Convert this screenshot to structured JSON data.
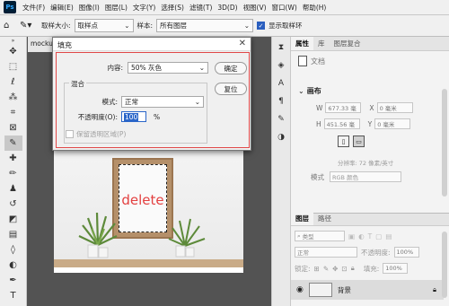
{
  "menubar": {
    "logo": "Ps",
    "items": [
      "文件(F)",
      "编辑(E)",
      "图像(I)",
      "图层(L)",
      "文字(Y)",
      "选择(S)",
      "滤镜(T)",
      "3D(D)",
      "视图(V)",
      "窗口(W)",
      "帮助(H)"
    ]
  },
  "options": {
    "sample_size_label": "取样大小:",
    "sample_size_value": "取样点",
    "sample_label": "样本:",
    "sample_value": "所有图层",
    "show_ring_label": "显示取样环"
  },
  "doc_tab": {
    "name": "mocku"
  },
  "canvas": {
    "frame_text": "delete"
  },
  "dialog": {
    "title": "填充",
    "content_label": "内容:",
    "content_value": "50% 灰色",
    "ok_label": "确定",
    "reset_label": "复位",
    "blend_group_label": "混合",
    "mode_label": "模式:",
    "mode_value": "正常",
    "opacity_label": "不透明度(O):",
    "opacity_value": "100",
    "opacity_unit": "%",
    "preserve_transparency_label": "保留透明区域(P)"
  },
  "properties": {
    "tabs": [
      "属性",
      "库",
      "图层复合"
    ],
    "doc_label": "文档",
    "canvas_section": "画布",
    "w_label": "W",
    "w_value": "677.33 毫",
    "h_label": "H",
    "h_value": "451.56 毫",
    "x_label": "X",
    "x_value": "0 毫米",
    "y_label": "Y",
    "y_value": "0 毫米",
    "resolution": "分辨率: 72 像素/英寸",
    "mode_label": "模式",
    "mode_value": "RGB 颜色"
  },
  "layers": {
    "tabs": [
      "图层",
      "路径"
    ],
    "filter_label": "类型",
    "blend_value": "正常",
    "opacity_label": "不透明度:",
    "opacity_value": "100%",
    "lock_label": "锁定:",
    "fill_label": "填充:",
    "fill_value": "100%",
    "layer_name": "背景"
  }
}
